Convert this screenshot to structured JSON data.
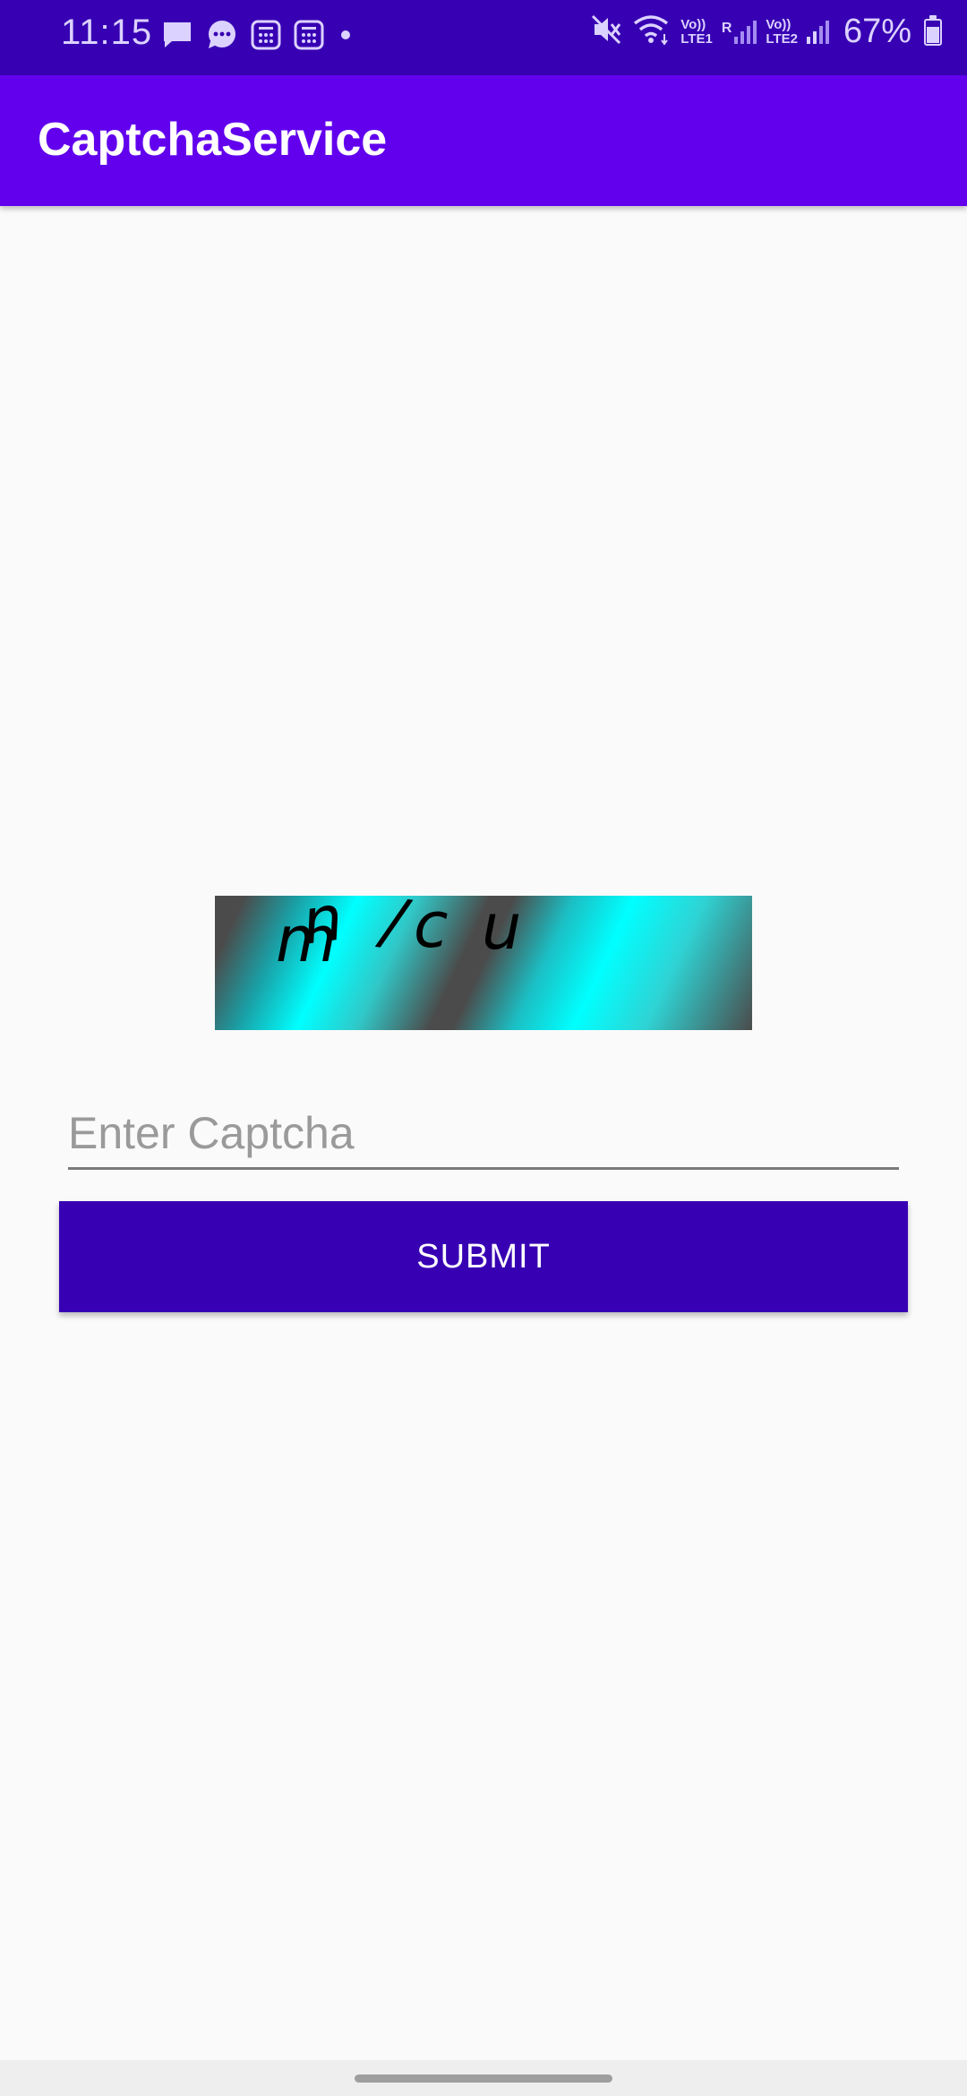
{
  "status_bar": {
    "time": "11:15",
    "battery_percent": "67%",
    "battery_level": 0.67,
    "sim1_volte": "Vo))",
    "sim1_network": "LTE1",
    "sim1_roaming": "R",
    "sim2_volte": "Vo))",
    "sim2_network": "LTE2",
    "left_icons": [
      "message-icon",
      "chat-bubble-icon",
      "calculator-icon",
      "calculator-icon",
      "dot-icon"
    ],
    "right_icons": [
      "mute-icon",
      "wifi-icon",
      "signal-icon",
      "signal-icon",
      "battery-icon"
    ]
  },
  "app_bar": {
    "title": "CaptchaService"
  },
  "captcha": {
    "characters": [
      {
        "char": "m",
        "color": "#33ff33"
      },
      {
        "char": "n",
        "color": "#ffffff"
      },
      {
        "char": "/",
        "color": "#ff33ff"
      },
      {
        "char": "c",
        "color": "#ff0000"
      },
      {
        "char": "u",
        "color": "#ffff00"
      }
    ]
  },
  "form": {
    "input_value": "",
    "input_placeholder": "Enter Captcha",
    "submit_label": "SUBMIT"
  },
  "colors": {
    "status_bar": "#3700b3",
    "app_bar": "#6200ee",
    "submit_button": "#3700b3",
    "background": "#fafafa"
  }
}
